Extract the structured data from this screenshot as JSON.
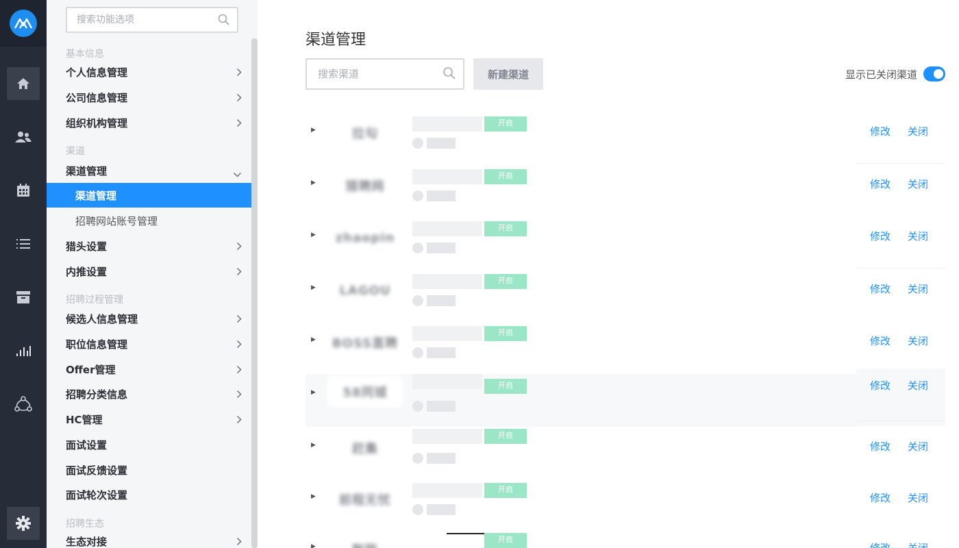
{
  "sidebar": {
    "search_placeholder": "搜索功能选项",
    "sections": [
      {
        "title": "基本信息"
      },
      {
        "title": "渠道"
      },
      {
        "title": "招聘过程管理"
      },
      {
        "title": "招聘生态"
      }
    ],
    "items": [
      {
        "label": "个人信息管理"
      },
      {
        "label": "公司信息管理"
      },
      {
        "label": "组织机构管理"
      },
      {
        "label": "渠道管理"
      },
      {
        "label": "渠道管理"
      },
      {
        "label": "招聘网站账号管理"
      },
      {
        "label": "猎头设置"
      },
      {
        "label": "内推设置"
      },
      {
        "label": "候选人信息管理"
      },
      {
        "label": "职位信息管理"
      },
      {
        "label": "Offer管理"
      },
      {
        "label": "招聘分类信息"
      },
      {
        "label": "HC管理"
      },
      {
        "label": "面试设置"
      },
      {
        "label": "面试反馈设置"
      },
      {
        "label": "面试轮次设置"
      },
      {
        "label": "生态对接"
      }
    ]
  },
  "main": {
    "title": "渠道管理",
    "search_placeholder": "搜索渠道",
    "new_button": "新建渠道",
    "toggle_label": "显示已关闭渠道",
    "toggle_on": true
  },
  "channels": [
    {
      "logo_text": "拉勾",
      "status": "开启",
      "edit": "修改",
      "close": "关闭"
    },
    {
      "logo_text": "猎聘网",
      "status": "开启",
      "edit": "修改",
      "close": "关闭"
    },
    {
      "logo_text": "zhaopin",
      "status": "开启",
      "edit": "修改",
      "close": "关闭"
    },
    {
      "logo_text": "LAGOU",
      "status": "开启",
      "edit": "修改",
      "close": "关闭"
    },
    {
      "logo_text": "BOSS直聘",
      "status": "开启",
      "edit": "修改",
      "close": "关闭"
    },
    {
      "logo_text": "58同城",
      "status": "开启",
      "edit": "修改",
      "close": "关闭"
    },
    {
      "logo_text": "赶集",
      "status": "开启",
      "edit": "修改",
      "close": "关闭"
    },
    {
      "logo_text": "前程无忧",
      "status": "开启",
      "edit": "修改",
      "close": "关闭"
    },
    {
      "logo_text": "智联",
      "status": "开启",
      "edit": "修改",
      "close": "关闭"
    }
  ],
  "colors": {
    "accent": "#1e90ff",
    "rail": "#262c38",
    "status": "#9ce6c8"
  }
}
